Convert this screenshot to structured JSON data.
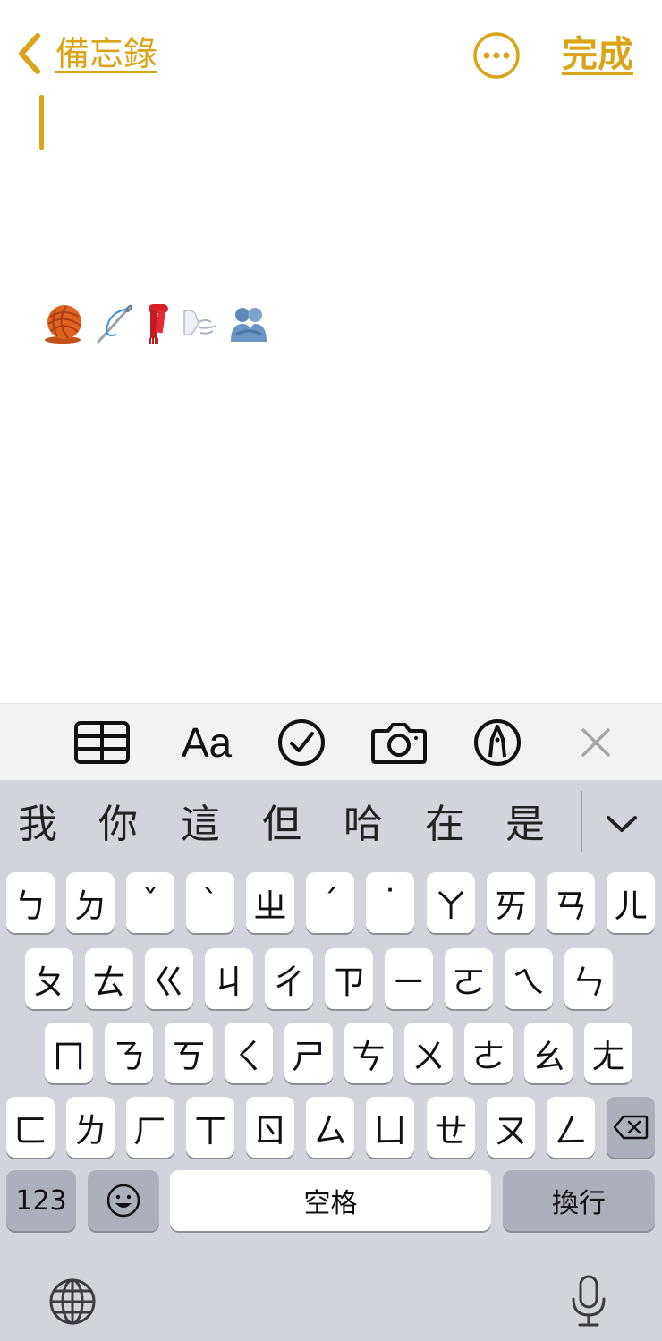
{
  "nav": {
    "back_label": "備忘錄",
    "done_label": "完成"
  },
  "note": {
    "emojis": [
      "yarn",
      "threaded-needle",
      "scarf",
      "wind-face",
      "people-hugging"
    ]
  },
  "toolbar": {
    "format_label": "Aa"
  },
  "candidates": [
    "我",
    "你",
    "這",
    "但",
    "哈",
    "在",
    "是"
  ],
  "keys": {
    "row1": [
      "ㄅ",
      "ㄉ",
      "ˇ",
      "ˋ",
      "ㄓ",
      "ˊ",
      "˙",
      "ㄚ",
      "ㄞ",
      "ㄢ",
      "ㄦ"
    ],
    "row2": [
      "ㄆ",
      "ㄊ",
      "ㄍ",
      "ㄐ",
      "ㄔ",
      "ㄗ",
      "ㄧ",
      "ㄛ",
      "ㄟ",
      "ㄣ"
    ],
    "row3": [
      "ㄇ",
      "ㄋ",
      "ㄎ",
      "ㄑ",
      "ㄕ",
      "ㄘ",
      "ㄨ",
      "ㄜ",
      "ㄠ",
      "ㄤ"
    ],
    "row4": [
      "ㄈ",
      "ㄌ",
      "ㄏ",
      "ㄒ",
      "ㄖ",
      "ㄙ",
      "ㄩ",
      "ㄝ",
      "ㄡ",
      "ㄥ"
    ],
    "numbers_label": "123",
    "space_label": "空格",
    "return_label": "換行"
  },
  "colors": {
    "accent": "#D9A418",
    "keyboard_bg": "#D1D4DB",
    "function_key": "#ABB0BA",
    "toolbar_bg": "#F2F2F4"
  }
}
